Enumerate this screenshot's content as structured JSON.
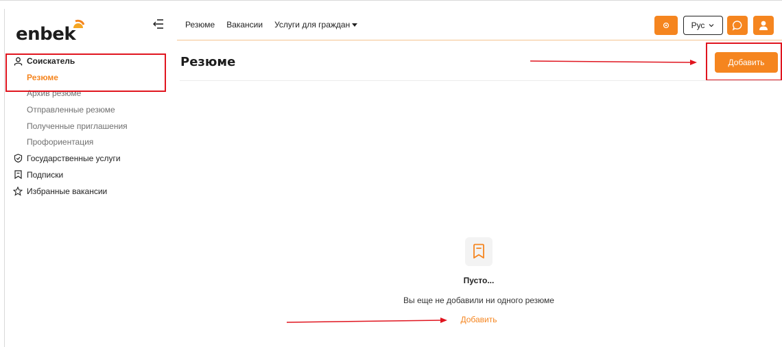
{
  "logo": {
    "text": "enbek"
  },
  "sidebar": {
    "items": [
      {
        "label": "Соискатель",
        "icon": "user-icon"
      },
      {
        "label": "Государственные услуги",
        "icon": "shield-check-icon"
      },
      {
        "label": "Подписки",
        "icon": "bookmark-icon"
      },
      {
        "label": "Избранные вакансии",
        "icon": "star-icon"
      }
    ],
    "subitems": [
      {
        "label": "Резюме",
        "active": true
      },
      {
        "label": "Архив резюме"
      },
      {
        "label": "Отправленные резюме"
      },
      {
        "label": "Полученные приглашения"
      },
      {
        "label": "Профориентация"
      }
    ]
  },
  "topnav": {
    "links": [
      "Резюме",
      "Вакансии",
      "Услуги для граждан"
    ],
    "language": "Рус"
  },
  "main": {
    "title": "Резюме",
    "add_button": "Добавить",
    "empty": {
      "title": "Пусто...",
      "description": "Вы еще не добавили ни одного резюме",
      "link": "Добавить"
    }
  },
  "colors": {
    "accent": "#f5851f",
    "highlight": "#e0141e"
  }
}
